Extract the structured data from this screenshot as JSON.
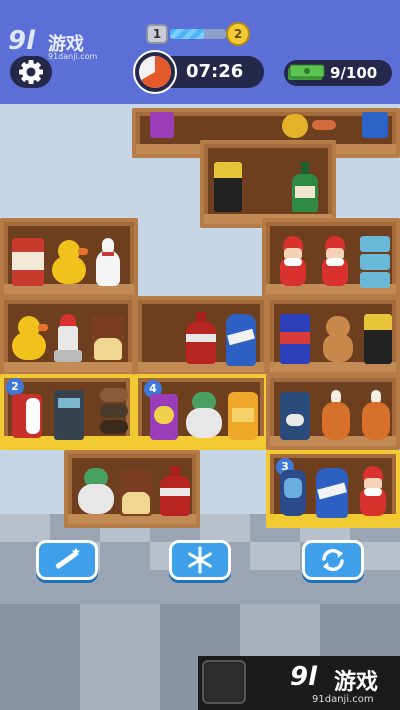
{
  "site_logo": {
    "mark": "9l",
    "name": "游戏",
    "domain": "91danji.com"
  },
  "level": {
    "current": "1",
    "next": "2",
    "progress": 0.6
  },
  "timer": {
    "value": "07:26"
  },
  "collected": {
    "value": "9/100"
  },
  "shelf_badges": {
    "a": "2",
    "b": "4",
    "c": "3"
  },
  "watermark": {
    "logo": "9l",
    "name": "游戏",
    "domain": "91danji.com"
  },
  "colors": {
    "header": "#5b6fd6",
    "accent": "#3ea0ea",
    "highlight": "#f2cb33",
    "shelf": "#a36a3b"
  },
  "icons": [
    "settings-gear-icon",
    "timer-pie-icon",
    "cash-stack-icon",
    "magic-wand-icon",
    "snowflake-icon",
    "shuffle-icon"
  ]
}
